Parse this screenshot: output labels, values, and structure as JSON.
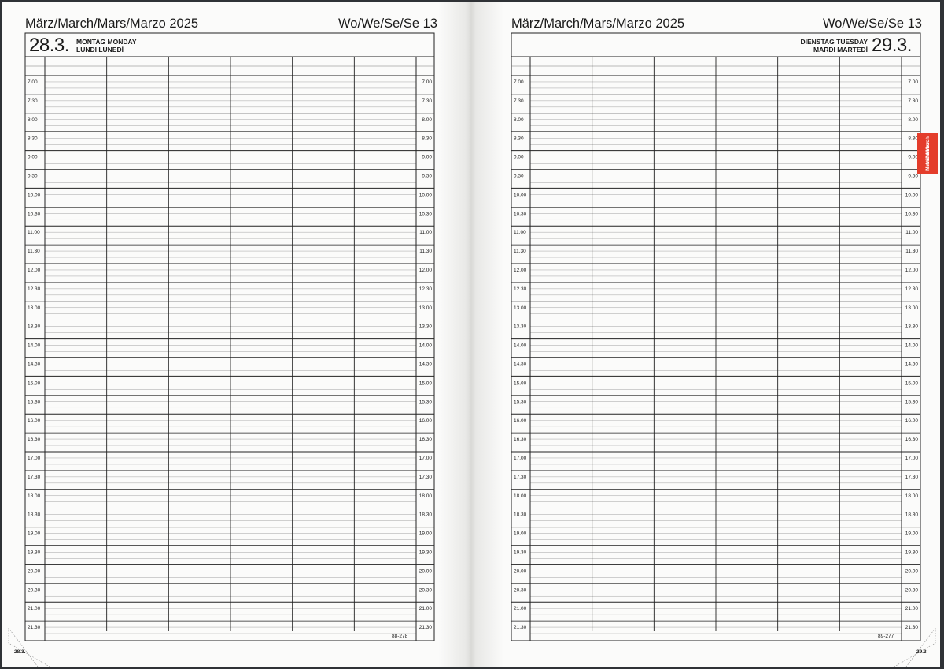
{
  "left_page": {
    "header_month": "März/March/Mars/Marzo 2025",
    "header_week": "Wo/We/Se/Se 13",
    "date": "28.3.",
    "day_names_line1": "MONTAG  MONDAY",
    "day_names_line2": "LUNDI  LUNEDÌ",
    "footer_code": "88-278",
    "corner_date": "28.3."
  },
  "right_page": {
    "header_month": "März/March/Mars/Marzo 2025",
    "header_week": "Wo/We/Se/Se 13",
    "date": "29.3.",
    "day_names_line1": "DIENSTAG  TUESDAY",
    "day_names_line2": "MARDI  MARTEDÌ",
    "footer_code": "89-277",
    "corner_date": "29.3."
  },
  "month_tab": {
    "line1": "März/March",
    "line2": "Mars/Marzo",
    "color": "#e43d2b"
  },
  "times": [
    "7.00",
    "7.30",
    "8.00",
    "8.30",
    "9.00",
    "9.30",
    "10.00",
    "10.30",
    "11.00",
    "11.30",
    "12.00",
    "12.30",
    "13.00",
    "13.30",
    "14.00",
    "14.30",
    "15.00",
    "15.30",
    "16.00",
    "16.30",
    "17.00",
    "17.30",
    "18.00",
    "18.30",
    "19.00",
    "19.30",
    "20.00",
    "20.30",
    "21.00",
    "21.30"
  ],
  "colors": {
    "page": "#fbfbfa",
    "background": "#2f3236",
    "ink": "#1a1a1a"
  }
}
